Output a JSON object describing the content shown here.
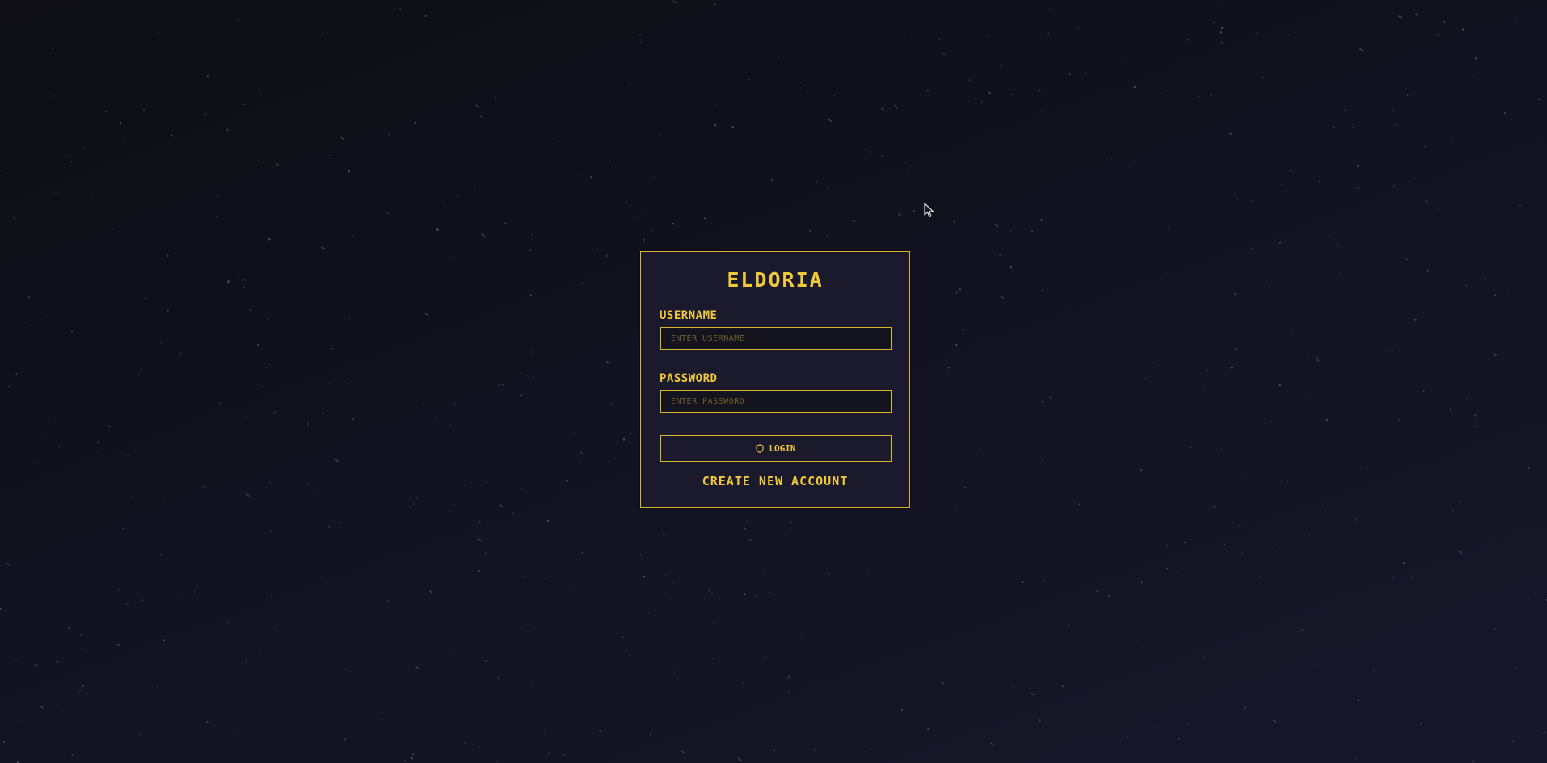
{
  "app": {
    "title": "ELDORIA"
  },
  "form": {
    "username_label": "USERNAME",
    "username_placeholder": "ENTER USERNAME",
    "username_value": "",
    "password_label": "PASSWORD",
    "password_placeholder": "ENTER PASSWORD",
    "password_value": "",
    "login_label": "LOGIN",
    "login_icon": "shield-icon",
    "create_account_label": "CREATE NEW ACCOUNT"
  },
  "colors": {
    "accent": "#f0c93a",
    "panel_bg": "#1b1a2c",
    "page_bg": "#121220"
  }
}
